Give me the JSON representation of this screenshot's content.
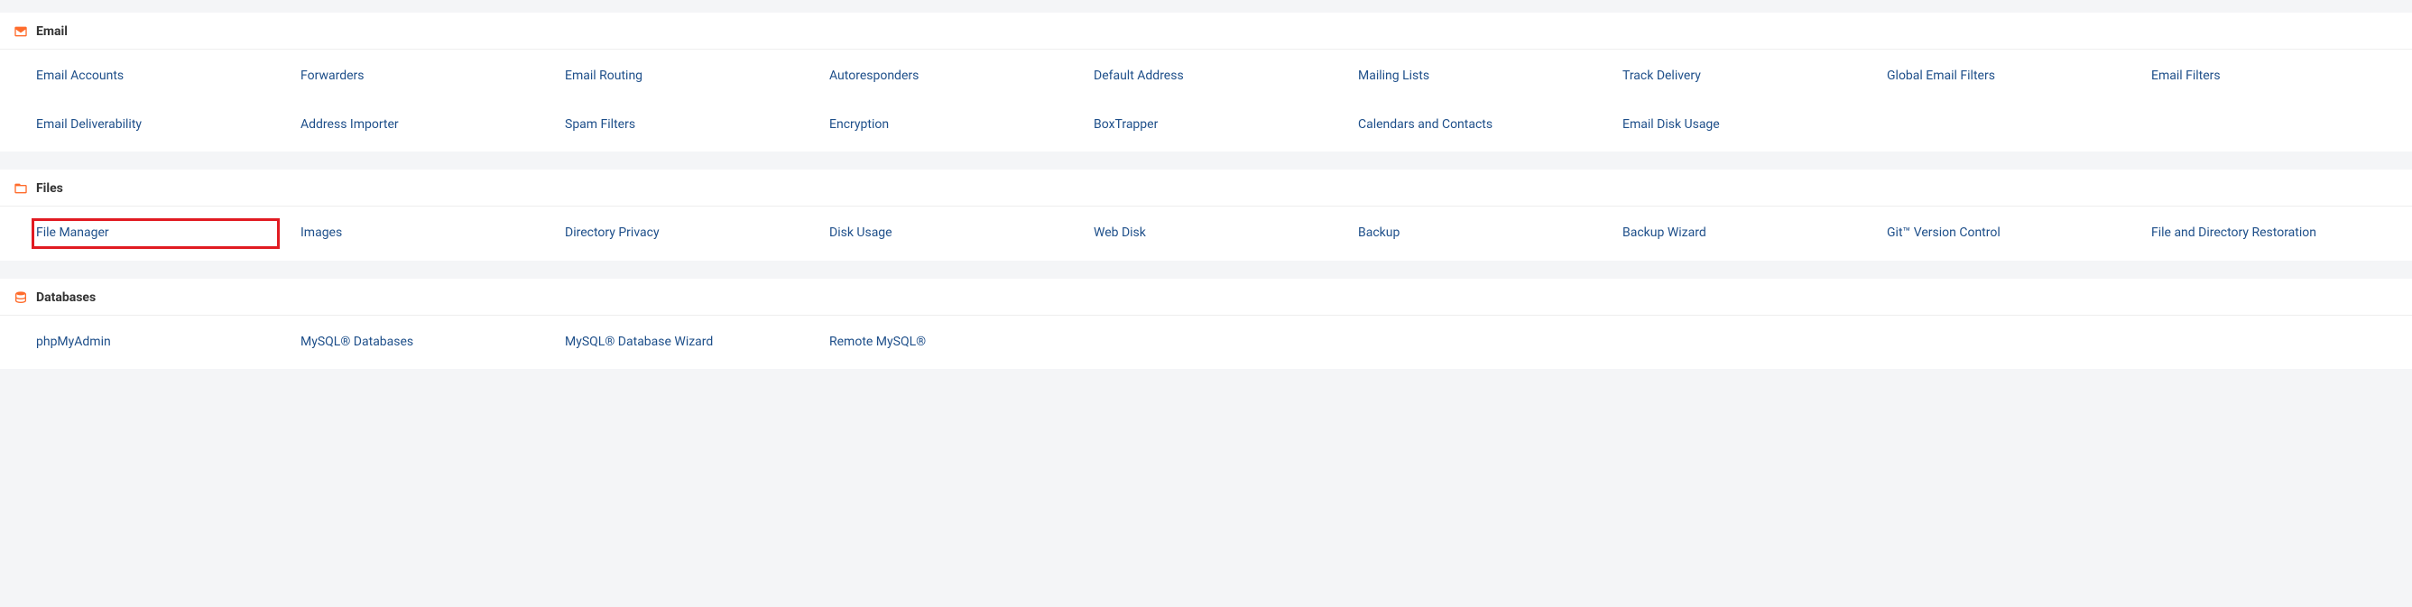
{
  "sections": [
    {
      "key": "email",
      "title": "Email",
      "icon": "envelope-icon",
      "items": [
        {
          "label": "Email Accounts",
          "highlight": false
        },
        {
          "label": "Forwarders",
          "highlight": false
        },
        {
          "label": "Email Routing",
          "highlight": false
        },
        {
          "label": "Autoresponders",
          "highlight": false
        },
        {
          "label": "Default Address",
          "highlight": false
        },
        {
          "label": "Mailing Lists",
          "highlight": false
        },
        {
          "label": "Track Delivery",
          "highlight": false
        },
        {
          "label": "Global Email Filters",
          "highlight": false
        },
        {
          "label": "Email Filters",
          "new_row_after": true,
          "highlight": false
        },
        {
          "label": "Email Deliverability",
          "highlight": false
        },
        {
          "label": "Address Importer",
          "highlight": false
        },
        {
          "label": "Spam Filters",
          "highlight": false
        },
        {
          "label": "Encryption",
          "highlight": false
        },
        {
          "label": "BoxTrapper",
          "highlight": false
        },
        {
          "label": "Calendars and Contacts",
          "highlight": false
        },
        {
          "label": "Email Disk Usage",
          "highlight": false
        }
      ]
    },
    {
      "key": "files",
      "title": "Files",
      "icon": "folder-open-icon",
      "items": [
        {
          "label": "File Manager",
          "highlight": true
        },
        {
          "label": "Images",
          "highlight": false
        },
        {
          "label": "Directory Privacy",
          "highlight": false
        },
        {
          "label": "Disk Usage",
          "highlight": false
        },
        {
          "label": "Web Disk",
          "highlight": false
        },
        {
          "label": "Backup",
          "highlight": false
        },
        {
          "label": "Backup Wizard",
          "highlight": false
        },
        {
          "label": "Git™ Version Control",
          "highlight": false
        },
        {
          "label": "File and Directory Restoration",
          "highlight": false
        }
      ]
    },
    {
      "key": "databases",
      "title": "Databases",
      "icon": "database-icon",
      "items": [
        {
          "label": "phpMyAdmin",
          "highlight": false
        },
        {
          "label": "MySQL® Databases",
          "highlight": false
        },
        {
          "label": "MySQL® Database Wizard",
          "highlight": false
        },
        {
          "label": "Remote MySQL®",
          "highlight": false
        }
      ]
    }
  ]
}
